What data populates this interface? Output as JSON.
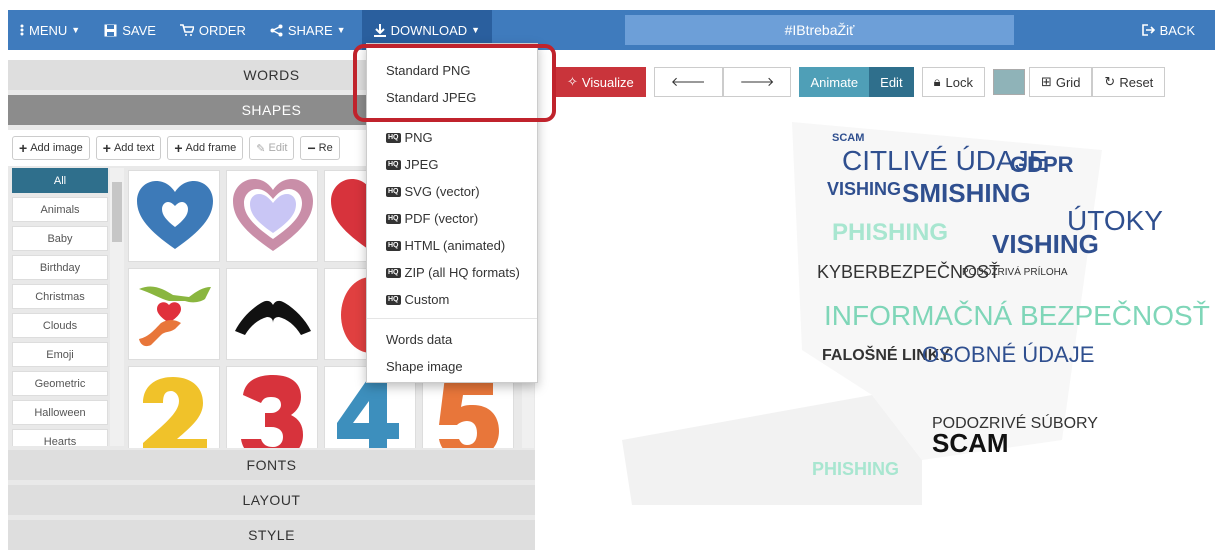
{
  "nav": {
    "menu": "MENU",
    "save": "SAVE",
    "order": "ORDER",
    "share": "SHARE",
    "download": "DOWNLOAD",
    "title": "#IBtrebaŽiť",
    "back": "BACK"
  },
  "panel": {
    "words": "WORDS",
    "shapes": "SHAPES",
    "fonts": "FONTS",
    "layout": "LAYOUT",
    "style": "STYLE"
  },
  "toolbar": {
    "add_image": "Add image",
    "add_text": "Add text",
    "add_frame": "Add frame",
    "edit": "Edit",
    "remove": "Re"
  },
  "categories": [
    "All",
    "Animals",
    "Baby",
    "Birthday",
    "Christmas",
    "Clouds",
    "Emoji",
    "Geometric",
    "Halloween",
    "Hearts"
  ],
  "viz": {
    "visualize": "Visualize",
    "animate": "Animate",
    "edit": "Edit",
    "lock": "Lock",
    "grid": "Grid",
    "reset": "Reset"
  },
  "download_menu": {
    "std_png": "Standard PNG",
    "std_jpeg": "Standard JPEG",
    "hq_badge": "HQ",
    "png": "PNG",
    "jpeg": "JPEG",
    "svg": "SVG (vector)",
    "pdf": "PDF (vector)",
    "html": "HTML (animated)",
    "zip": "ZIP (all HQ formats)",
    "custom": "Custom",
    "words_data": "Words data",
    "shape_image": "Shape image"
  },
  "wordcloud": {
    "words": [
      "SCAM",
      "CITLIVÉ ÚDAJE",
      "GDPR",
      "VISHING",
      "SMISHING",
      "ÚTOKY",
      "PHISHING",
      "KYBERBEZPEČNOSŤ",
      "PODOZRIVÁ PRÍLOHA",
      "INFORMAČNÁ BEZPEČNOSŤ",
      "FALOŠNÉ LINKY",
      "OSOBNÉ ÚDAJE",
      "PODOZRIVÉ SÚBORY"
    ]
  },
  "colors": {
    "topbar": "#3f7bbd",
    "download_active": "#2a5f9e",
    "highlight": "#c0232c",
    "accent_teal": "#2f6f8c"
  }
}
